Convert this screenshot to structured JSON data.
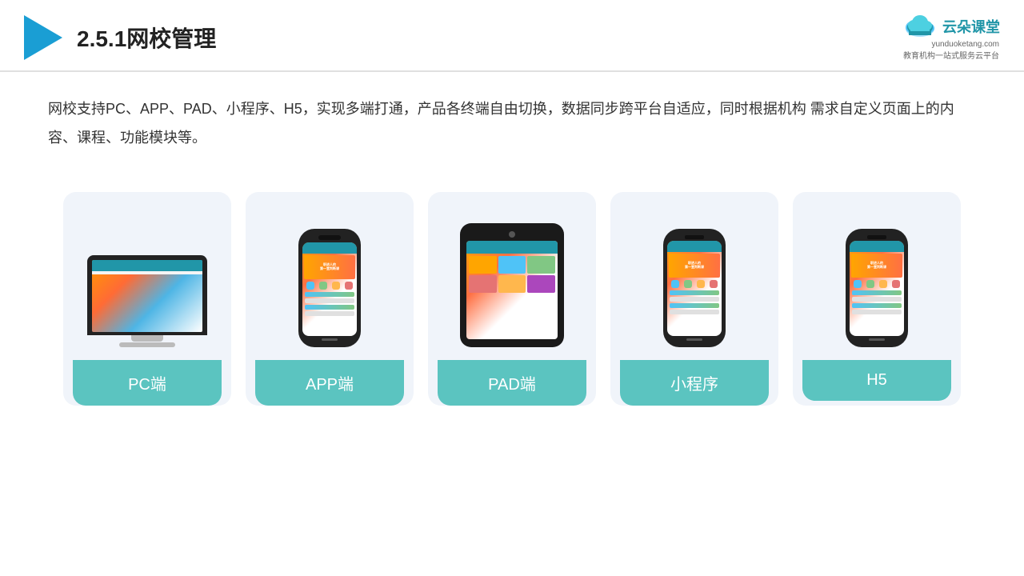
{
  "header": {
    "title": "2.5.1网校管理",
    "brand": {
      "name": "云朵课堂",
      "url": "yunduoketang.com",
      "tagline": "教育机构一站\n式服务云平台"
    }
  },
  "description": "网校支持PC、APP、PAD、小程序、H5，实现多端打通，产品各终端自由切换，数据同步跨平台自适应，同时根据机构\n需求自定义页面上的内容、课程、功能模块等。",
  "cards": [
    {
      "id": "pc",
      "label": "PC端",
      "device": "pc"
    },
    {
      "id": "app",
      "label": "APP端",
      "device": "phone"
    },
    {
      "id": "pad",
      "label": "PAD端",
      "device": "tablet"
    },
    {
      "id": "miniprogram",
      "label": "小程序",
      "device": "phone"
    },
    {
      "id": "h5",
      "label": "H5",
      "device": "phone"
    }
  ],
  "colors": {
    "teal": "#5bc4c0",
    "blue": "#2196a8",
    "accent": "#1a9ed4"
  }
}
